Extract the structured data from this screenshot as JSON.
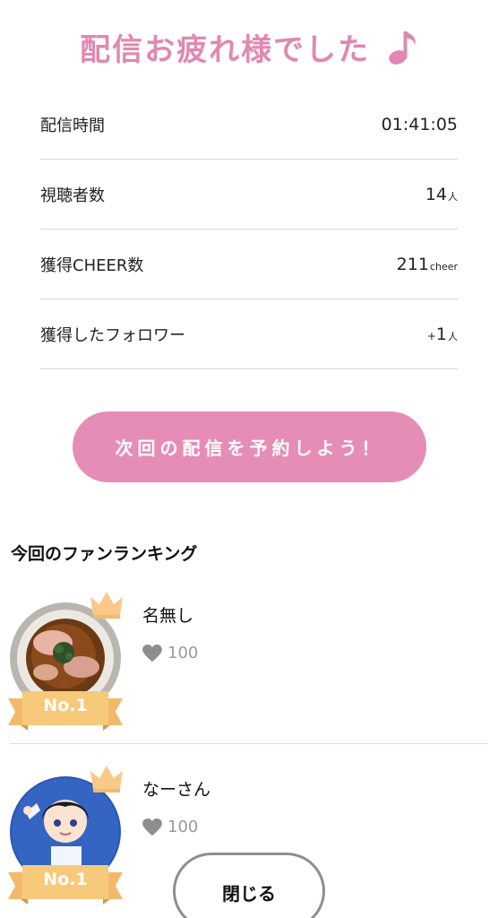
{
  "title": "配信お疲れ様でした",
  "title_icon": "music-note-icon",
  "stats": [
    {
      "label": "配信時間",
      "value": "01:41:05",
      "prefix": "",
      "unit": ""
    },
    {
      "label": "視聴者数",
      "value": "14",
      "prefix": "",
      "unit": "人"
    },
    {
      "label": "獲得CHEER数",
      "value": "211",
      "prefix": "",
      "unit": "cheer"
    },
    {
      "label": "獲得したフォロワー",
      "value": "1",
      "prefix": "+",
      "unit": "人"
    }
  ],
  "reserve_button": "次回の配信を予約しよう！",
  "ranking": {
    "title": "今回のファンランキング",
    "fans": [
      {
        "name": "名無し",
        "likes": "100",
        "rank": "No.1",
        "avatar": "ramen-bowl-photo"
      },
      {
        "name": "なーさん",
        "likes": "100",
        "rank": "No.1",
        "avatar": "anime-character-illustration"
      }
    ]
  },
  "close_button": "閉じる",
  "colors": {
    "accent_pink": "#e68db7",
    "title_pink": "#e088b2",
    "ribbon_gold": "#f7c97a",
    "muted_gray": "#9a9a9a"
  }
}
